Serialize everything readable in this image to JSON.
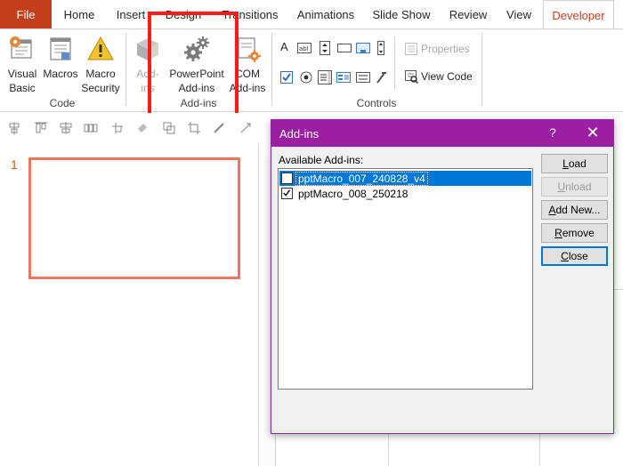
{
  "tabs": [
    {
      "label": "File"
    },
    {
      "label": "Home"
    },
    {
      "label": "Insert"
    },
    {
      "label": "Design"
    },
    {
      "label": "Transitions"
    },
    {
      "label": "Animations"
    },
    {
      "label": "Slide Show"
    },
    {
      "label": "Review"
    },
    {
      "label": "View"
    },
    {
      "label": "Developer"
    }
  ],
  "ribbon": {
    "code_group": {
      "label": "Code",
      "visual_basic": {
        "line1": "Visual",
        "line2": "Basic"
      },
      "macros": {
        "line1": "Macros"
      },
      "macro_security": {
        "line1": "Macro",
        "line2": "Security"
      }
    },
    "addins_group": {
      "label": "Add-ins",
      "addins": {
        "line1": "Add-",
        "line2": "ins"
      },
      "powerpoint_addins": {
        "line1": "PowerPoint",
        "line2": "Add-ins"
      },
      "com_addins": {
        "line1": "COM",
        "line2": "Add-ins"
      }
    },
    "controls_group": {
      "label": "Controls",
      "properties": "Properties",
      "view_code": "View Code"
    }
  },
  "slides": [
    {
      "number": "1"
    }
  ],
  "dialog": {
    "title": "Add-ins",
    "help": "?",
    "close_glyph": "✕",
    "available_label": "Available Add-ins:",
    "items": [
      {
        "name": "pptMacro_007_240828_v4",
        "checked": false,
        "selected": true
      },
      {
        "name": "pptMacro_008_250218",
        "checked": true,
        "selected": false
      }
    ],
    "buttons": {
      "load": {
        "mnemonic": "L",
        "rest": "oad"
      },
      "unload": {
        "mnemonic": "U",
        "rest": "nload"
      },
      "add_new": {
        "mnemonic": "A",
        "rest": "dd New..."
      },
      "remove": {
        "mnemonic": "R",
        "rest": "emove"
      },
      "close": {
        "mnemonic": "C",
        "rest": "lose"
      }
    }
  },
  "colors": {
    "file_tab": "#c43e1c",
    "accent_tab": "#c43e1c",
    "dialog_titlebar": "#9b1fa0",
    "selection": "#0078d7",
    "highlight_box": "#ff1a1a",
    "slide_border": "#e9785c"
  }
}
